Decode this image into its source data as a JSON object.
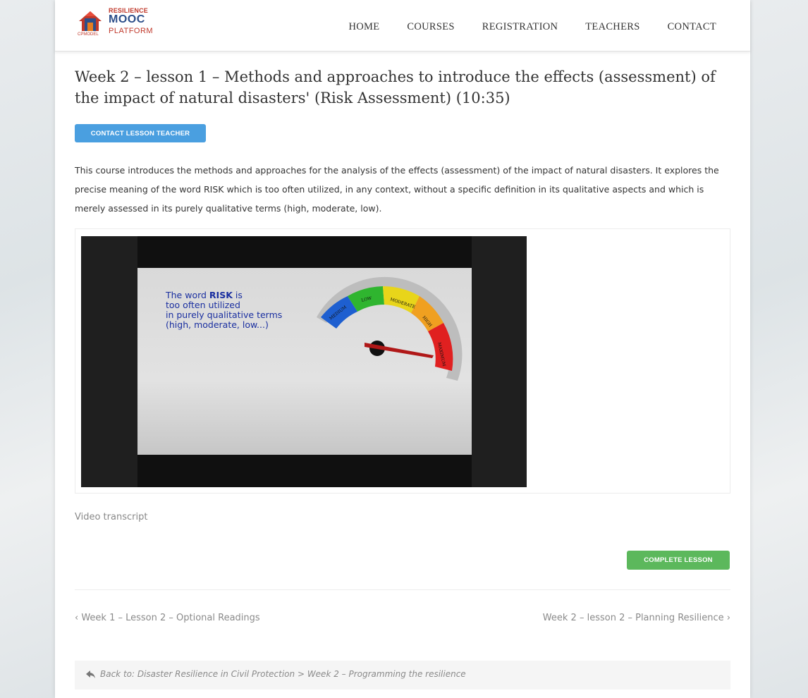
{
  "logo": {
    "small_text": "RESILIENCE",
    "main_text": "MOOC",
    "sub_text": "PLATFORM",
    "mark_text": "CPMODEL"
  },
  "nav": {
    "items": [
      "HOME",
      "COURSES",
      "REGISTRATION",
      "TEACHERS",
      "CONTACT"
    ]
  },
  "lesson": {
    "title": "Week 2 – lesson 1 – Methods and approaches to introduce the effects (assessment) of the impact of natural disasters' (Risk Assessment) (10:35)",
    "contact_button": "CONTACT LESSON TEACHER",
    "description": "This course introduces the methods and approaches for the analysis of the effects (assessment) of the impact of natural disasters. It explores the precise meaning of the word RISK which is too often utilized, in any context, without a specific definition in its qualitative aspects and which is merely assessed in its purely qualitative terms (high, moderate, low)."
  },
  "video": {
    "slide_line1_pre": "The word ",
    "slide_line1_bold": "RISK",
    "slide_line1_post": " is",
    "slide_line2": "too often utilized",
    "slide_line3": "in purely qualitative terms",
    "slide_line4": "(high, moderate, low...)",
    "gauge_labels": [
      "MEDIUM",
      "LOW",
      "MODERATE",
      "HIGH",
      "MAXIMUM"
    ],
    "gauge_colors": [
      "#1e5fd0",
      "#2fb52f",
      "#e8d51a",
      "#f0a020",
      "#e02020"
    ]
  },
  "transcript_label": "Video transcript",
  "complete_button": "COMPLETE LESSON",
  "pagination": {
    "prev": "‹ Week 1 – Lesson 2 – Optional Readings",
    "next": "Week 2 – lesson 2 – Planning Resilience ›"
  },
  "back": {
    "prefix": "Back to: ",
    "course": "Disaster Resilience in Civil Protection",
    "separator": " > ",
    "section": "Week 2 – Programming the resilience"
  }
}
